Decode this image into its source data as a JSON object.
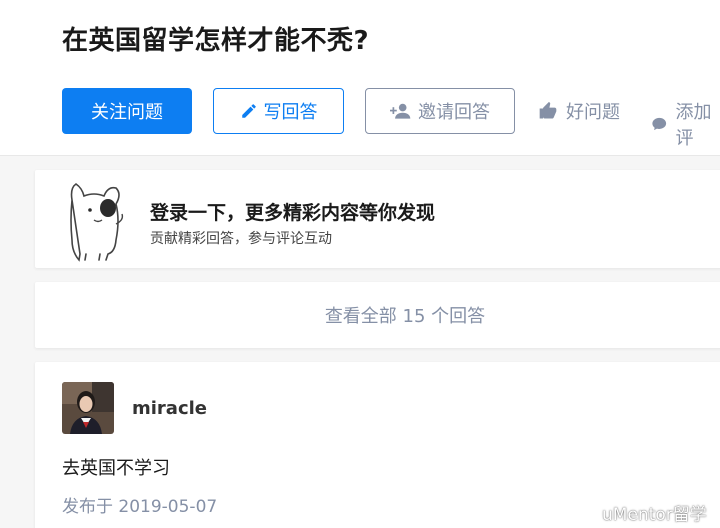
{
  "question": {
    "title": "在英国留学怎样才能不秃?"
  },
  "actions": {
    "follow_label": "关注问题",
    "write_label": "写回答",
    "invite_label": "邀请回答",
    "good_label": "好问题",
    "comment_label": "添加评"
  },
  "login_prompt": {
    "title": "登录一下，更多精彩内容等你发现",
    "subtitle": "贡献精彩回答，参与评论互动"
  },
  "view_all": {
    "label": "查看全部 15 个回答"
  },
  "answer": {
    "author": "miracle",
    "content": "去英国不学习",
    "date": "发布于 2019-05-07"
  },
  "watermark": {
    "text": "uMentor留学"
  },
  "colors": {
    "primary": "#0d7ef2",
    "muted": "#8590a6",
    "background": "#f6f6f6"
  }
}
